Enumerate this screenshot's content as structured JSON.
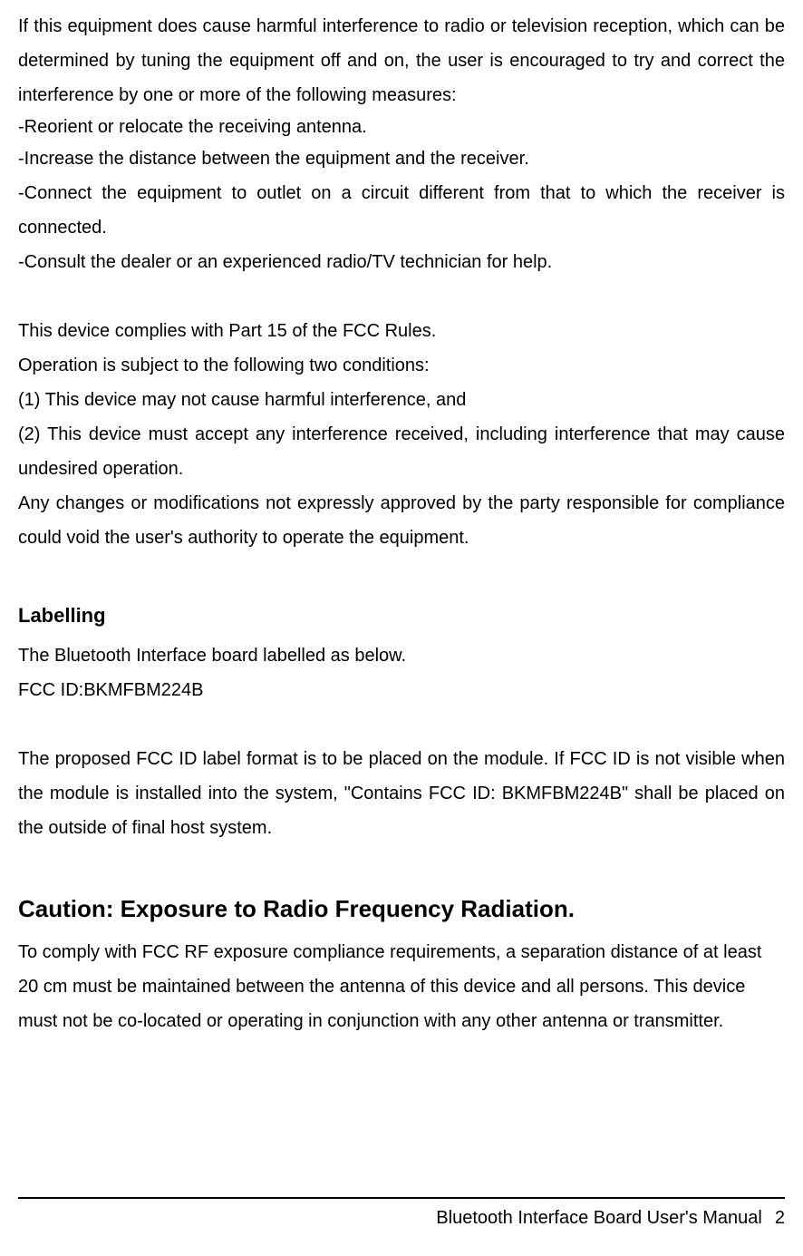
{
  "intro": "If this equipment does cause harmful interference to radio or television reception, which can be determined by tuning the equipment off and on, the user is encouraged to try and correct the interference by one or more of the following measures:",
  "measures": {
    "m1": "-Reorient or relocate the receiving antenna.",
    "m2": "-Increase the distance between the equipment and the receiver.",
    "m3": "-Connect the equipment to outlet on a circuit different from that to which the receiver is connected.",
    "m4": "-Consult the dealer or an experienced radio/TV technician for help."
  },
  "compliance": {
    "p1": "This device complies with Part 15 of the FCC Rules.",
    "p2": "Operation is subject to the following two conditions:",
    "c1": "(1) This device may not cause harmful interference, and",
    "c2": "(2) This device must accept any interference received, including interference that may cause undesired operation.",
    "p3": "Any changes or modifications not expressly approved by the party responsible for compliance could void the user's authority to operate the equipment."
  },
  "labelling": {
    "heading": "Labelling",
    "p1": "The Bluetooth Interface board labelled as below.",
    "p2": "FCC ID:BKMFBM224B",
    "p3": "The proposed FCC ID label format is to be placed on the module. If FCC ID is not visible when the module is installed into the system, \"Contains FCC ID: BKMFBM224B\" shall be placed on the outside of final host system."
  },
  "caution": {
    "heading": "Caution: Exposure to Radio Frequency Radiation.",
    "p1": "To comply with FCC RF exposure compliance requirements, a separation distance of at least 20 cm must be maintained between the antenna of this device and all persons. This device must not be co-located or operating in conjunction with any other antenna or transmitter."
  },
  "footer": {
    "title": "Bluetooth Interface Board User's Manual",
    "page": "2"
  }
}
